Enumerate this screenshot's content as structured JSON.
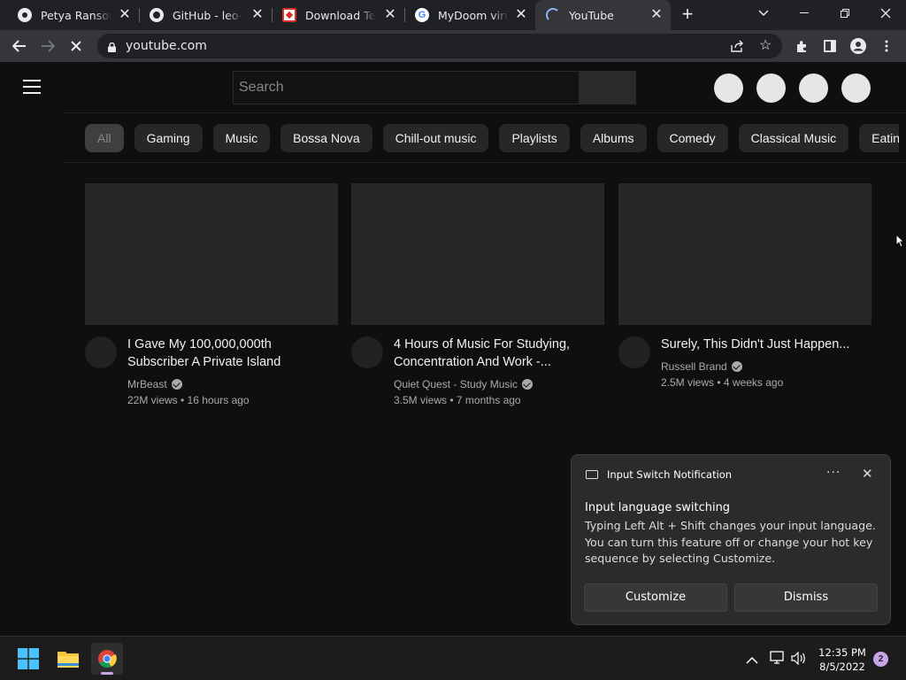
{
  "browser": {
    "tabs": [
      {
        "title": "Petya Ransomware",
        "icon": "globe-icon"
      },
      {
        "title": "GitHub - leo-stone",
        "icon": "github-icon"
      },
      {
        "title": "Download Test Virus",
        "icon": "download-icon"
      },
      {
        "title": "MyDoom virus - Google",
        "icon": "google-icon"
      },
      {
        "title": "YouTube",
        "icon": "loading-icon"
      }
    ],
    "address": "youtube.com"
  },
  "youtube": {
    "search_placeholder": "Search",
    "chips": [
      "All",
      "Gaming",
      "Music",
      "Bossa Nova",
      "Chill-out music",
      "Playlists",
      "Albums",
      "Comedy",
      "Classical Music",
      "Eating"
    ],
    "videos": [
      {
        "title": "I Gave My 100,000,000th Subscriber A Private Island",
        "channel": "MrBeast",
        "meta": "22M views • 16 hours ago"
      },
      {
        "title": "4 Hours of Music For Studying, Concentration And Work -...",
        "channel": "Quiet Quest - Study Music",
        "meta": "3.5M views • 7 months ago"
      },
      {
        "title": "Surely, This Didn't Just Happen...",
        "channel": "Russell Brand",
        "meta": "2.5M views • 4 weeks ago"
      }
    ]
  },
  "notification": {
    "app": "Input Switch Notification",
    "title": "Input language switching",
    "body": "Typing Left Alt + Shift changes your input language. You can turn this feature off or change your hot key sequence by selecting Customize.",
    "customize_label": "Customize",
    "dismiss_label": "Dismiss"
  },
  "taskbar": {
    "time": "12:35 PM",
    "date": "8/5/2022",
    "notification_count": "2"
  },
  "colors": {
    "page_bg": "#0f0f0f",
    "chip_bg": "#272727",
    "thumb_bg": "#272727",
    "taskbar_bg": "#1c1c1c",
    "badge": "#c7a4e6"
  }
}
